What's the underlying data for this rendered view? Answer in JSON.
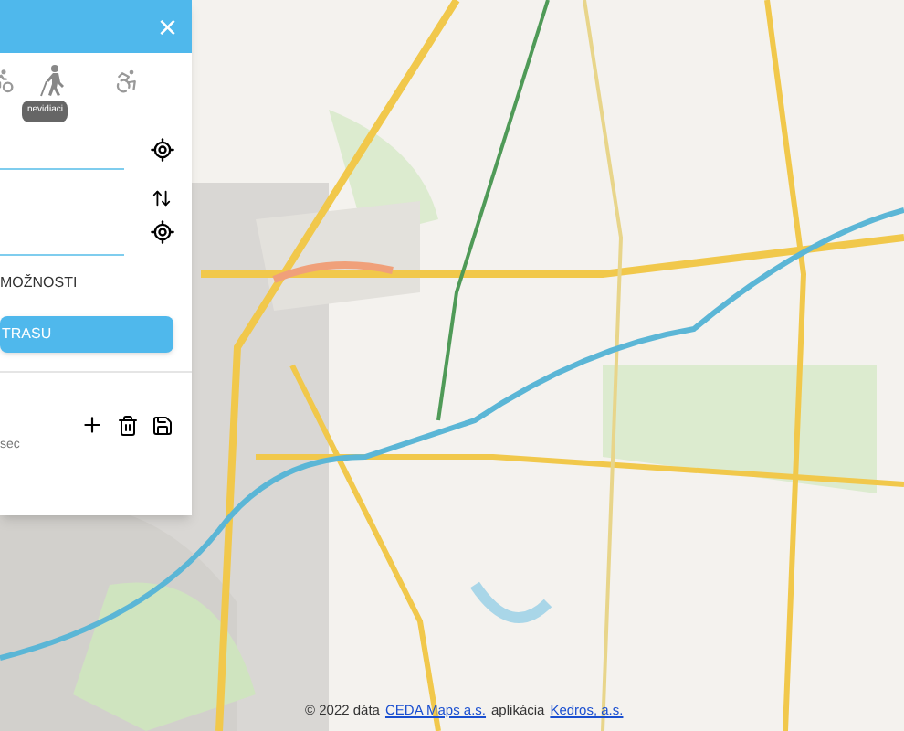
{
  "panel": {
    "close": "×",
    "transport_modes": [
      {
        "kind": "bike"
      },
      {
        "kind": "blind"
      },
      {
        "kind": "wheelchair"
      }
    ],
    "tooltip": "nevidiaci",
    "options_label": "MOŽNOSTI",
    "route_button": "TRASU",
    "saved_route": {
      "duration": "sec"
    }
  },
  "attribution": {
    "prefix": "© 2022 dáta",
    "maps_link": "CEDA Maps a.s.",
    "middle": "aplikácia",
    "app_link": "Kedros, a.s."
  }
}
